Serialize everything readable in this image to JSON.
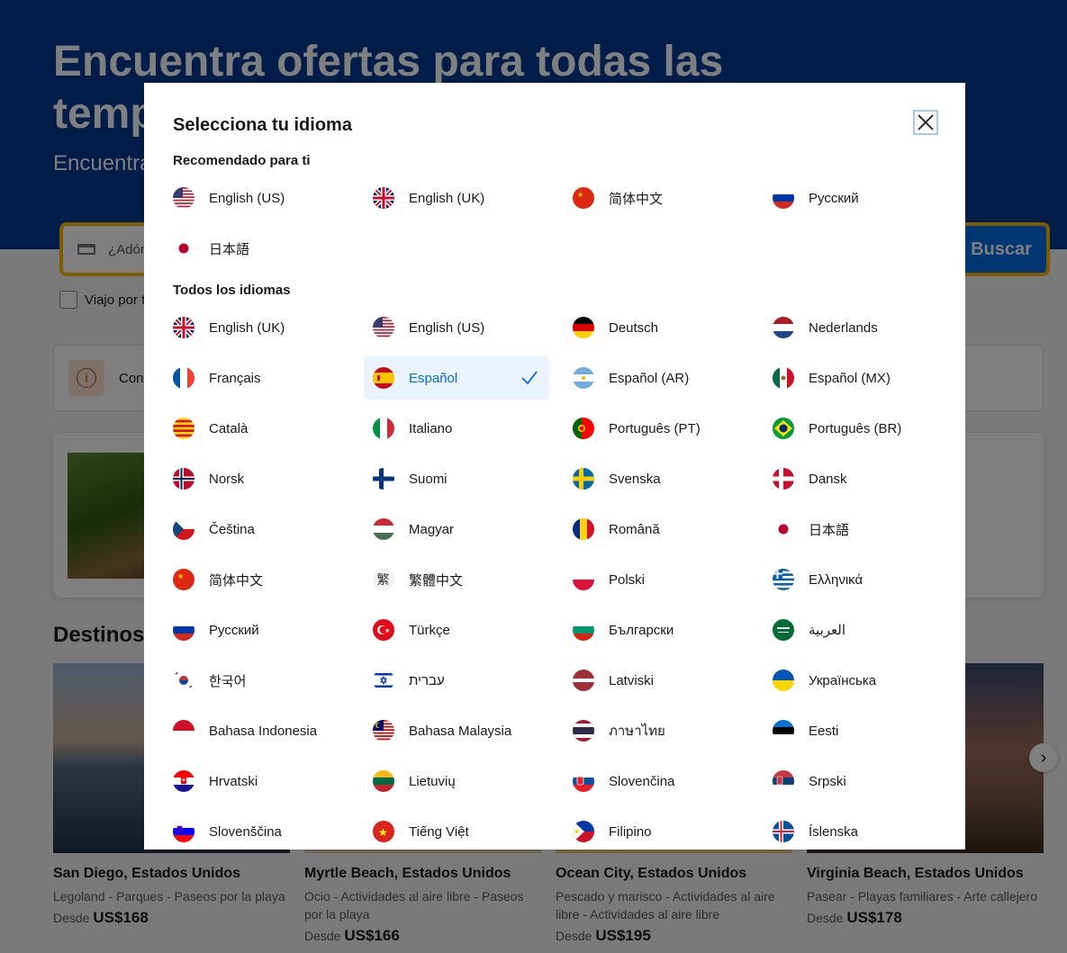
{
  "hero": {
    "title": "Encuentra ofertas para todas las temporadas",
    "subtitle": "Encuentra"
  },
  "search": {
    "destination_placeholder": "¿Adónde",
    "button_label": "Buscar",
    "trip_checkbox_label": "Viajo por t"
  },
  "notice": {
    "text": "Cons"
  },
  "destinations": {
    "heading": "Destinos",
    "cards": [
      {
        "name": "San Diego, Estados Unidos",
        "tags": "Legoland - Parques - Paseos por la playa",
        "price_prefix": "Desde",
        "price": "US$168"
      },
      {
        "name": "Myrtle Beach, Estados Unidos",
        "tags": "Ocio - Actividades al aire libre - Paseos por la playa",
        "price_prefix": "Desde",
        "price": "US$166"
      },
      {
        "name": "Ocean City, Estados Unidos",
        "tags": "Pescado y marisco - Actividades al aire libre - Actividades al aire libre",
        "price_prefix": "Desde",
        "price": "US$195"
      },
      {
        "name": "Virginia Beach, Estados Unidos",
        "tags": "Pasear - Playas familiares - Arte callejero",
        "price_prefix": "Desde",
        "price": "US$178"
      }
    ]
  },
  "modal": {
    "title": "Selecciona tu idioma",
    "recommended_title": "Recomendado para ti",
    "all_title": "Todos los idiomas",
    "recommended": [
      {
        "label": "English (US)",
        "flag": "us"
      },
      {
        "label": "English (UK)",
        "flag": "uk"
      },
      {
        "label": "简体中文",
        "flag": "cn"
      },
      {
        "label": "Русский",
        "flag": "ru"
      },
      {
        "label": "日本語",
        "flag": "jp"
      }
    ],
    "all": [
      {
        "label": "English (UK)",
        "flag": "uk"
      },
      {
        "label": "English (US)",
        "flag": "us"
      },
      {
        "label": "Deutsch",
        "flag": "de"
      },
      {
        "label": "Nederlands",
        "flag": "nl"
      },
      {
        "label": "Français",
        "flag": "fr"
      },
      {
        "label": "Español",
        "flag": "es",
        "selected": true
      },
      {
        "label": "Español (AR)",
        "flag": "ar"
      },
      {
        "label": "Español (MX)",
        "flag": "mx"
      },
      {
        "label": "Català",
        "flag": "ca"
      },
      {
        "label": "Italiano",
        "flag": "it"
      },
      {
        "label": "Português (PT)",
        "flag": "pt"
      },
      {
        "label": "Português (BR)",
        "flag": "br"
      },
      {
        "label": "Norsk",
        "flag": "no"
      },
      {
        "label": "Suomi",
        "flag": "fi"
      },
      {
        "label": "Svenska",
        "flag": "se"
      },
      {
        "label": "Dansk",
        "flag": "dk"
      },
      {
        "label": "Čeština",
        "flag": "cz"
      },
      {
        "label": "Magyar",
        "flag": "hu"
      },
      {
        "label": "Română",
        "flag": "ro"
      },
      {
        "label": "日本語",
        "flag": "jp"
      },
      {
        "label": "简体中文",
        "flag": "cn"
      },
      {
        "label": "繁體中文",
        "flag": "zh-trad"
      },
      {
        "label": "Polski",
        "flag": "pl"
      },
      {
        "label": "Ελληνικά",
        "flag": "gr"
      },
      {
        "label": "Русский",
        "flag": "ru"
      },
      {
        "label": "Türkçe",
        "flag": "tr"
      },
      {
        "label": "Български",
        "flag": "bg"
      },
      {
        "label": "العربية",
        "flag": "sa"
      },
      {
        "label": "한국어",
        "flag": "kr"
      },
      {
        "label": "עברית",
        "flag": "il"
      },
      {
        "label": "Latviski",
        "flag": "lv"
      },
      {
        "label": "Українська",
        "flag": "ua"
      },
      {
        "label": "Bahasa Indonesia",
        "flag": "id"
      },
      {
        "label": "Bahasa Malaysia",
        "flag": "my"
      },
      {
        "label": "ภาษาไทย",
        "flag": "th"
      },
      {
        "label": "Eesti",
        "flag": "ee"
      },
      {
        "label": "Hrvatski",
        "flag": "hr"
      },
      {
        "label": "Lietuvių",
        "flag": "lt"
      },
      {
        "label": "Slovenčina",
        "flag": "sk"
      },
      {
        "label": "Srpski",
        "flag": "rs"
      },
      {
        "label": "Slovenščina",
        "flag": "si"
      },
      {
        "label": "Tiếng Việt",
        "flag": "vn"
      },
      {
        "label": "Filipino",
        "flag": "ph"
      },
      {
        "label": "Íslenska",
        "flag": "is"
      }
    ]
  },
  "colors": {
    "brand_blue": "#003b95",
    "action_blue": "#006ce4",
    "selected_bg": "#ebf3ff",
    "search_border": "#ffb700"
  }
}
